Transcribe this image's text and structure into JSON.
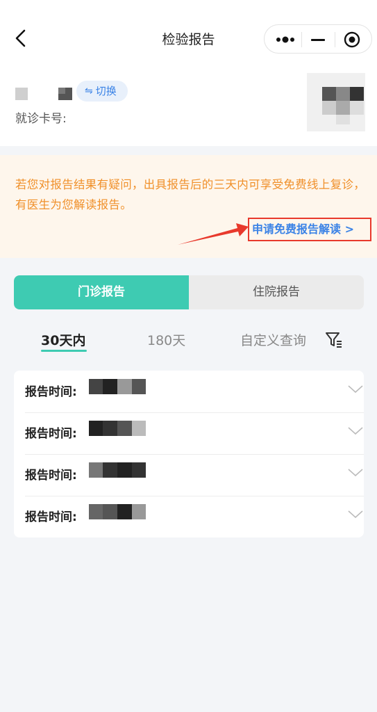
{
  "nav": {
    "title": "检验报告"
  },
  "patient": {
    "switch_label": "切换",
    "switch_icon": "⇋",
    "card_no_label": "就诊卡号:"
  },
  "notice": {
    "text": "若您对报告结果有疑问，出具报告后的三天内可享受免费线上复诊，有医生为您解读报告。",
    "apply_link": "申请免费报告解读 >"
  },
  "segment": {
    "tabs": [
      "门诊报告",
      "住院报告"
    ],
    "active": 0
  },
  "range": {
    "tabs": [
      "30天内",
      "180天",
      "自定义查询"
    ],
    "active": 0
  },
  "reports": [
    {
      "label": "报告时间:"
    },
    {
      "label": "报告时间:"
    },
    {
      "label": "报告时间:"
    },
    {
      "label": "报告时间:"
    }
  ],
  "colors": {
    "accent": "#3ecbb2",
    "link": "#3b83e6",
    "notice_text": "#f0902a",
    "annotation": "#e8392c"
  }
}
